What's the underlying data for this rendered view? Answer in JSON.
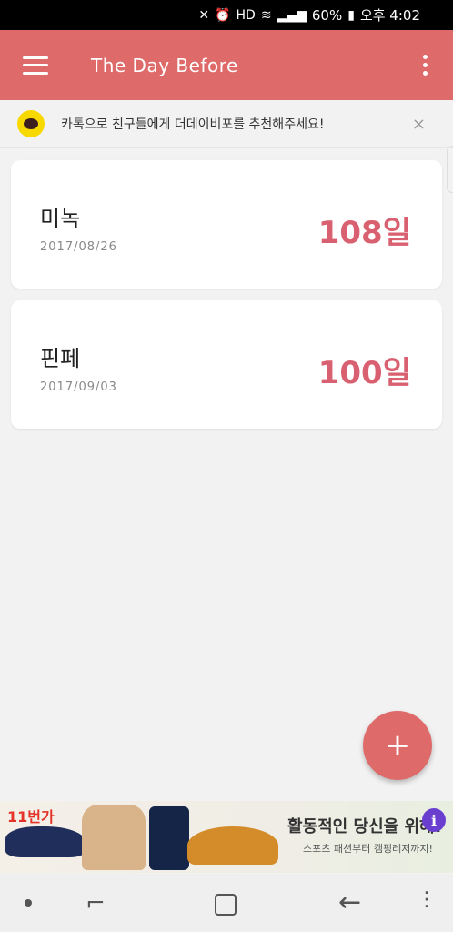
{
  "status_bar": {
    "icons": [
      "mute-icon",
      "alarm-icon",
      "hd-icon",
      "wifi-icon",
      "signal-icon",
      "battery-icon"
    ],
    "hd": "HD",
    "battery": "60%",
    "time": "오후 4:02"
  },
  "app_bar": {
    "title": "The Day Before",
    "color": "#df6a6a"
  },
  "banner": {
    "text": "카톡으로 친구들에게 더데이비포를 추천해주세요!",
    "close": "×"
  },
  "events": [
    {
      "name": "미녹",
      "date": "2017/08/26",
      "days": "108일"
    },
    {
      "name": "핀페",
      "date": "2017/09/03",
      "days": "100일"
    }
  ],
  "fab": {
    "label": "+"
  },
  "ad": {
    "brand": "11번가",
    "headline": "활동적인 당신을 위해!",
    "sub": "스포츠 패션부터 캠핑레저까지!",
    "info": "i"
  },
  "nav": {
    "recent": "⌐",
    "back": "←",
    "more": "⋮"
  },
  "accent_color": "#d96070"
}
